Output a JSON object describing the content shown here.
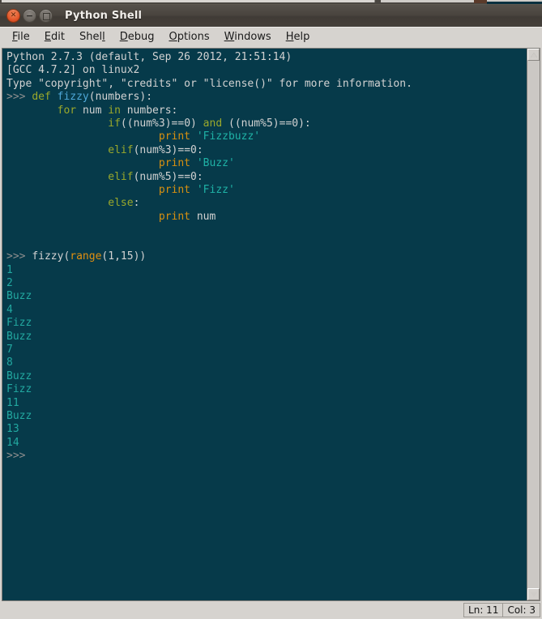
{
  "window": {
    "title": "Python Shell",
    "controls": [
      {
        "name": "close",
        "glyph": "✕"
      },
      {
        "name": "minimize",
        "glyph": "−"
      },
      {
        "name": "maximize",
        "glyph": ""
      }
    ]
  },
  "menubar": {
    "items": [
      {
        "label": "File",
        "mnemonic": "F"
      },
      {
        "label": "Edit",
        "mnemonic": "E"
      },
      {
        "label": "Shell",
        "mnemonic": "l"
      },
      {
        "label": "Debug",
        "mnemonic": "D"
      },
      {
        "label": "Options",
        "mnemonic": "O"
      },
      {
        "label": "Windows",
        "mnemonic": "W"
      },
      {
        "label": "Help",
        "mnemonic": "H"
      }
    ]
  },
  "shell": {
    "banner": [
      "Python 2.7.3 (default, Sep 26 2012, 21:51:14)",
      "[GCC 4.7.2] on linux2",
      "Type \"copyright\", \"credits\" or \"license()\" for more information."
    ],
    "prompt": ">>>",
    "source_lines": [
      ">>> def fizzy(numbers):",
      "        for num in numbers:",
      "                if((num%3)==0) and ((num%5)==0):",
      "                        print 'Fizzbuzz'",
      "                elif(num%3)==0:",
      "                        print 'Buzz'",
      "                elif(num%5)==0:",
      "                        print 'Fizz'",
      "                else:",
      "                        print num"
    ],
    "call_line": ">>> fizzy(range(1,15))",
    "output_lines": [
      "1",
      "2",
      "Buzz",
      "4",
      "Fizz",
      "Buzz",
      "7",
      "8",
      "Buzz",
      "Fizz",
      "11",
      "Buzz",
      "13",
      "14"
    ],
    "trailing_prompt": ">>>",
    "colors": {
      "background": "#063a4a",
      "default_text": "#d2d2d2",
      "prompt": "#8e8e8e",
      "keyword": "#9aa82b",
      "definition": "#4fa8d8",
      "builtin": "#e09010",
      "print_keyword": "#d89010",
      "string": "#1fb2a6",
      "output": "#22a8a0"
    }
  },
  "scrollbar": {
    "up_arrow": "scroll-up",
    "down_arrow": "scroll-down"
  },
  "statusbar": {
    "line_label": "Ln: 11",
    "col_label": "Col: 3"
  }
}
